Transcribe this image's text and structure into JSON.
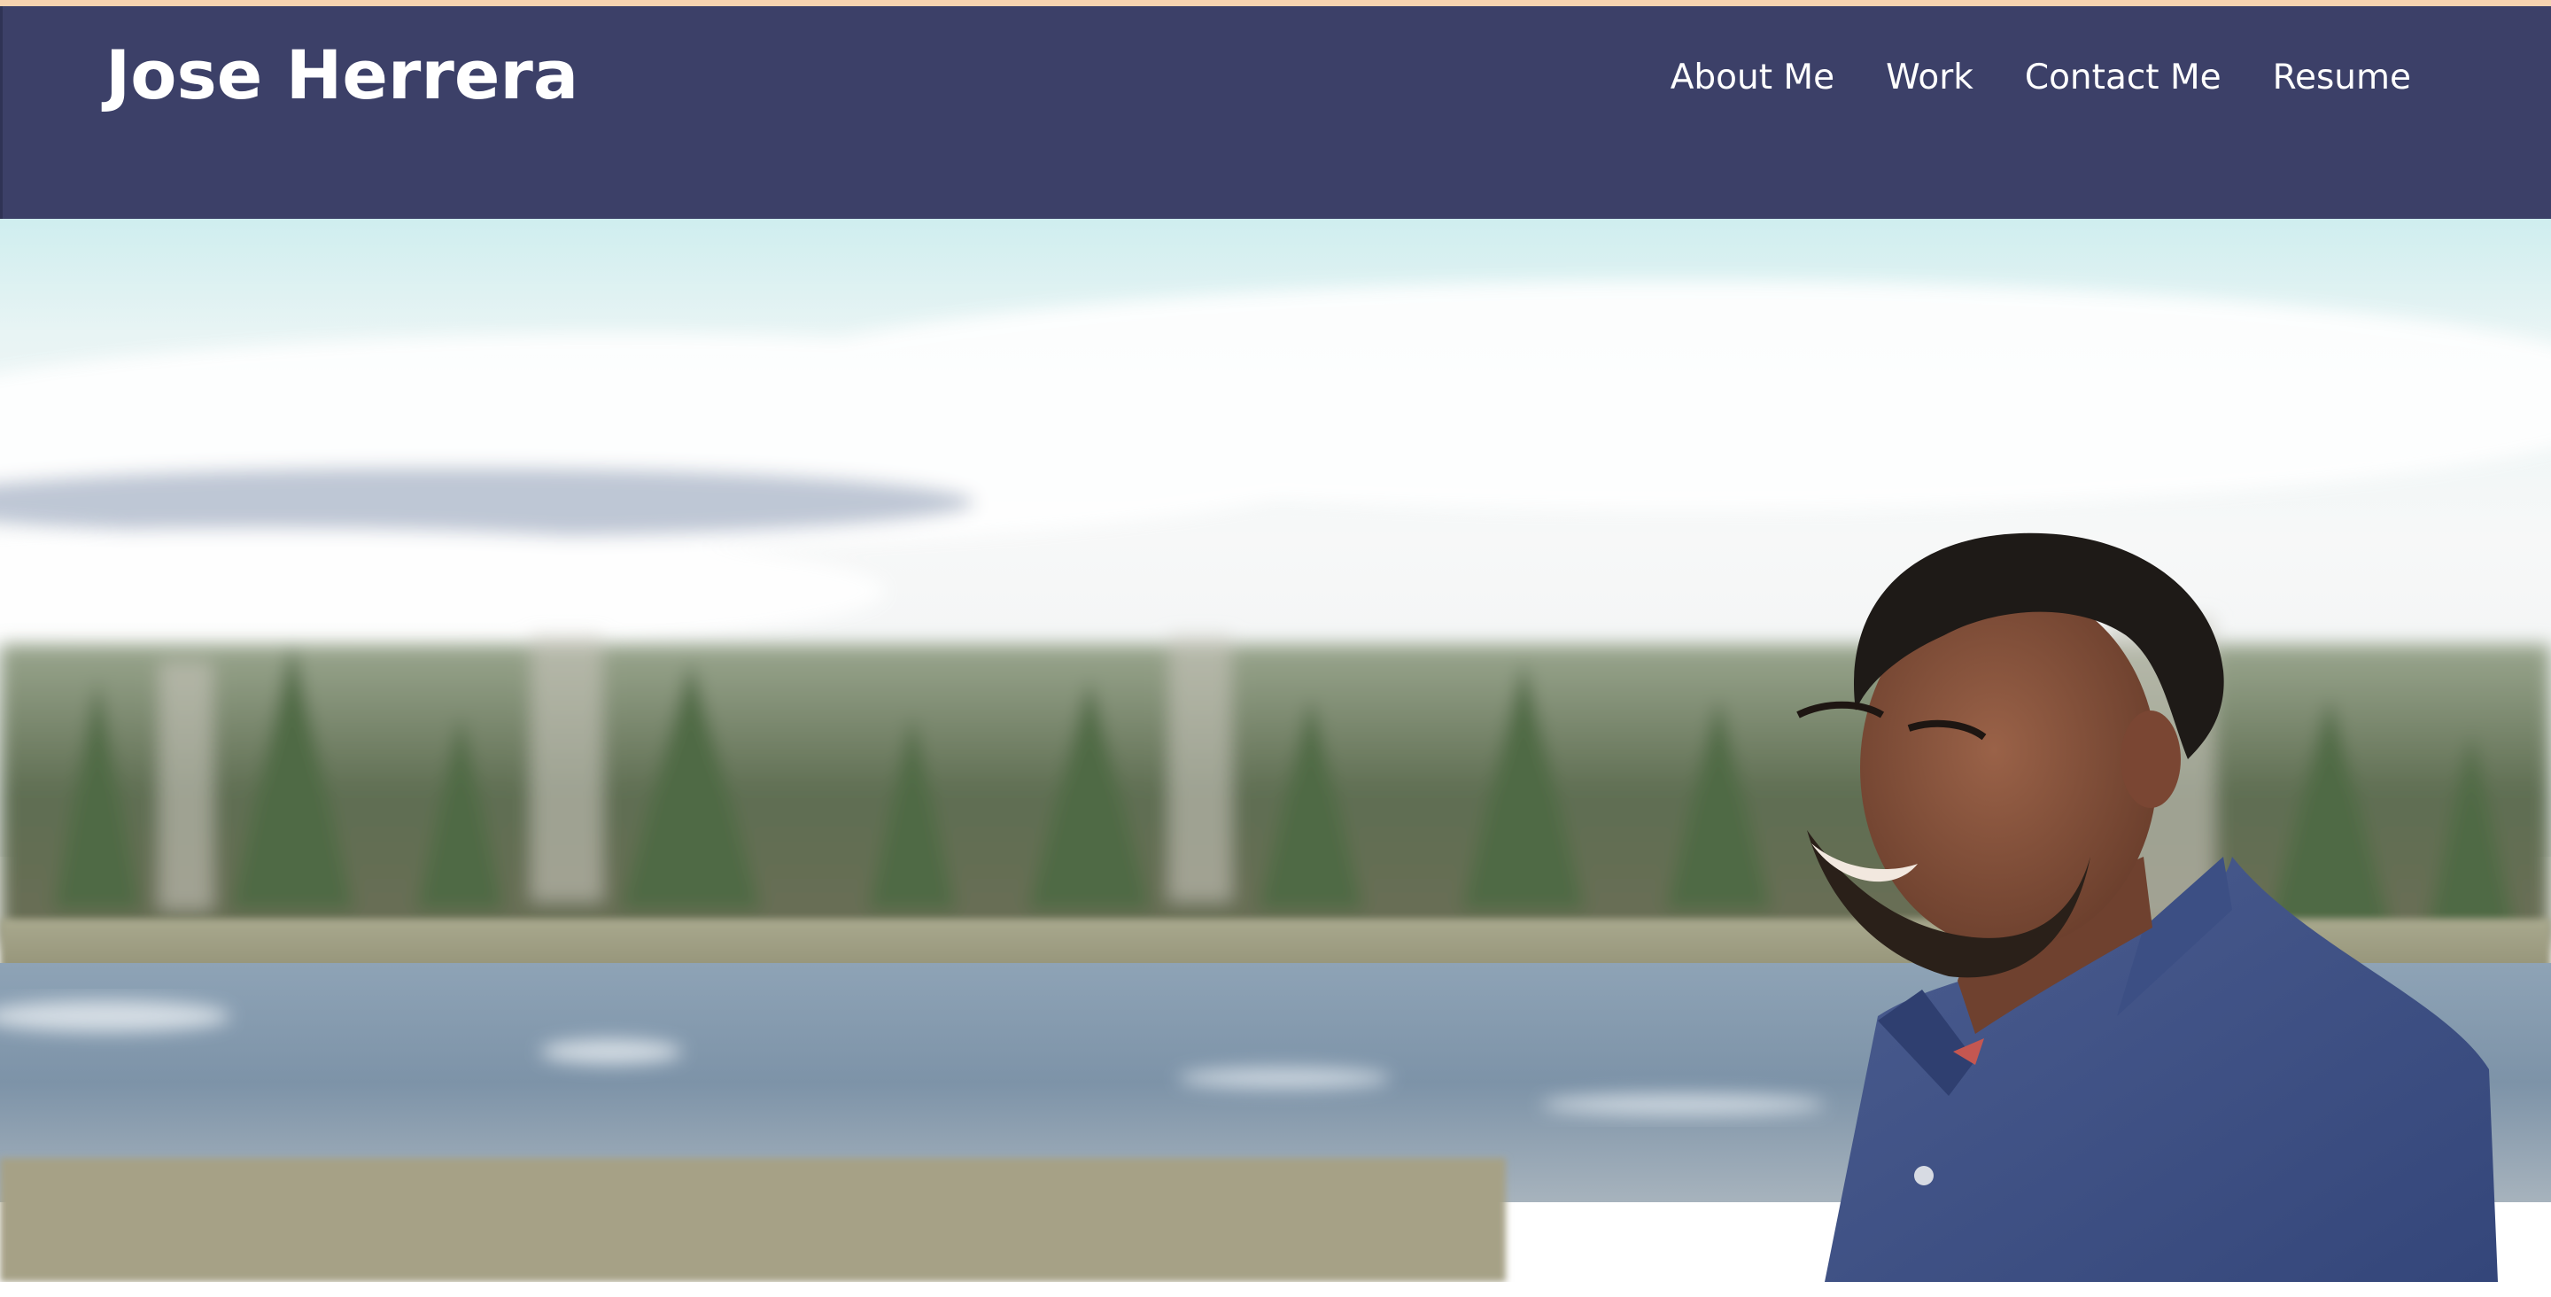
{
  "site": {
    "title": "Jose Herrera"
  },
  "nav": {
    "items": [
      {
        "label": "About Me",
        "name": "nav-link-about-me"
      },
      {
        "label": "Work",
        "name": "nav-link-work"
      },
      {
        "label": "Contact Me",
        "name": "nav-link-contact-me"
      },
      {
        "label": "Resume",
        "name": "nav-link-resume"
      }
    ]
  },
  "colors": {
    "header_bg": "#3c4068",
    "top_accent": "#f6d3b0",
    "nav_text": "#ffffff"
  },
  "hero": {
    "icon": "hero-photo"
  }
}
